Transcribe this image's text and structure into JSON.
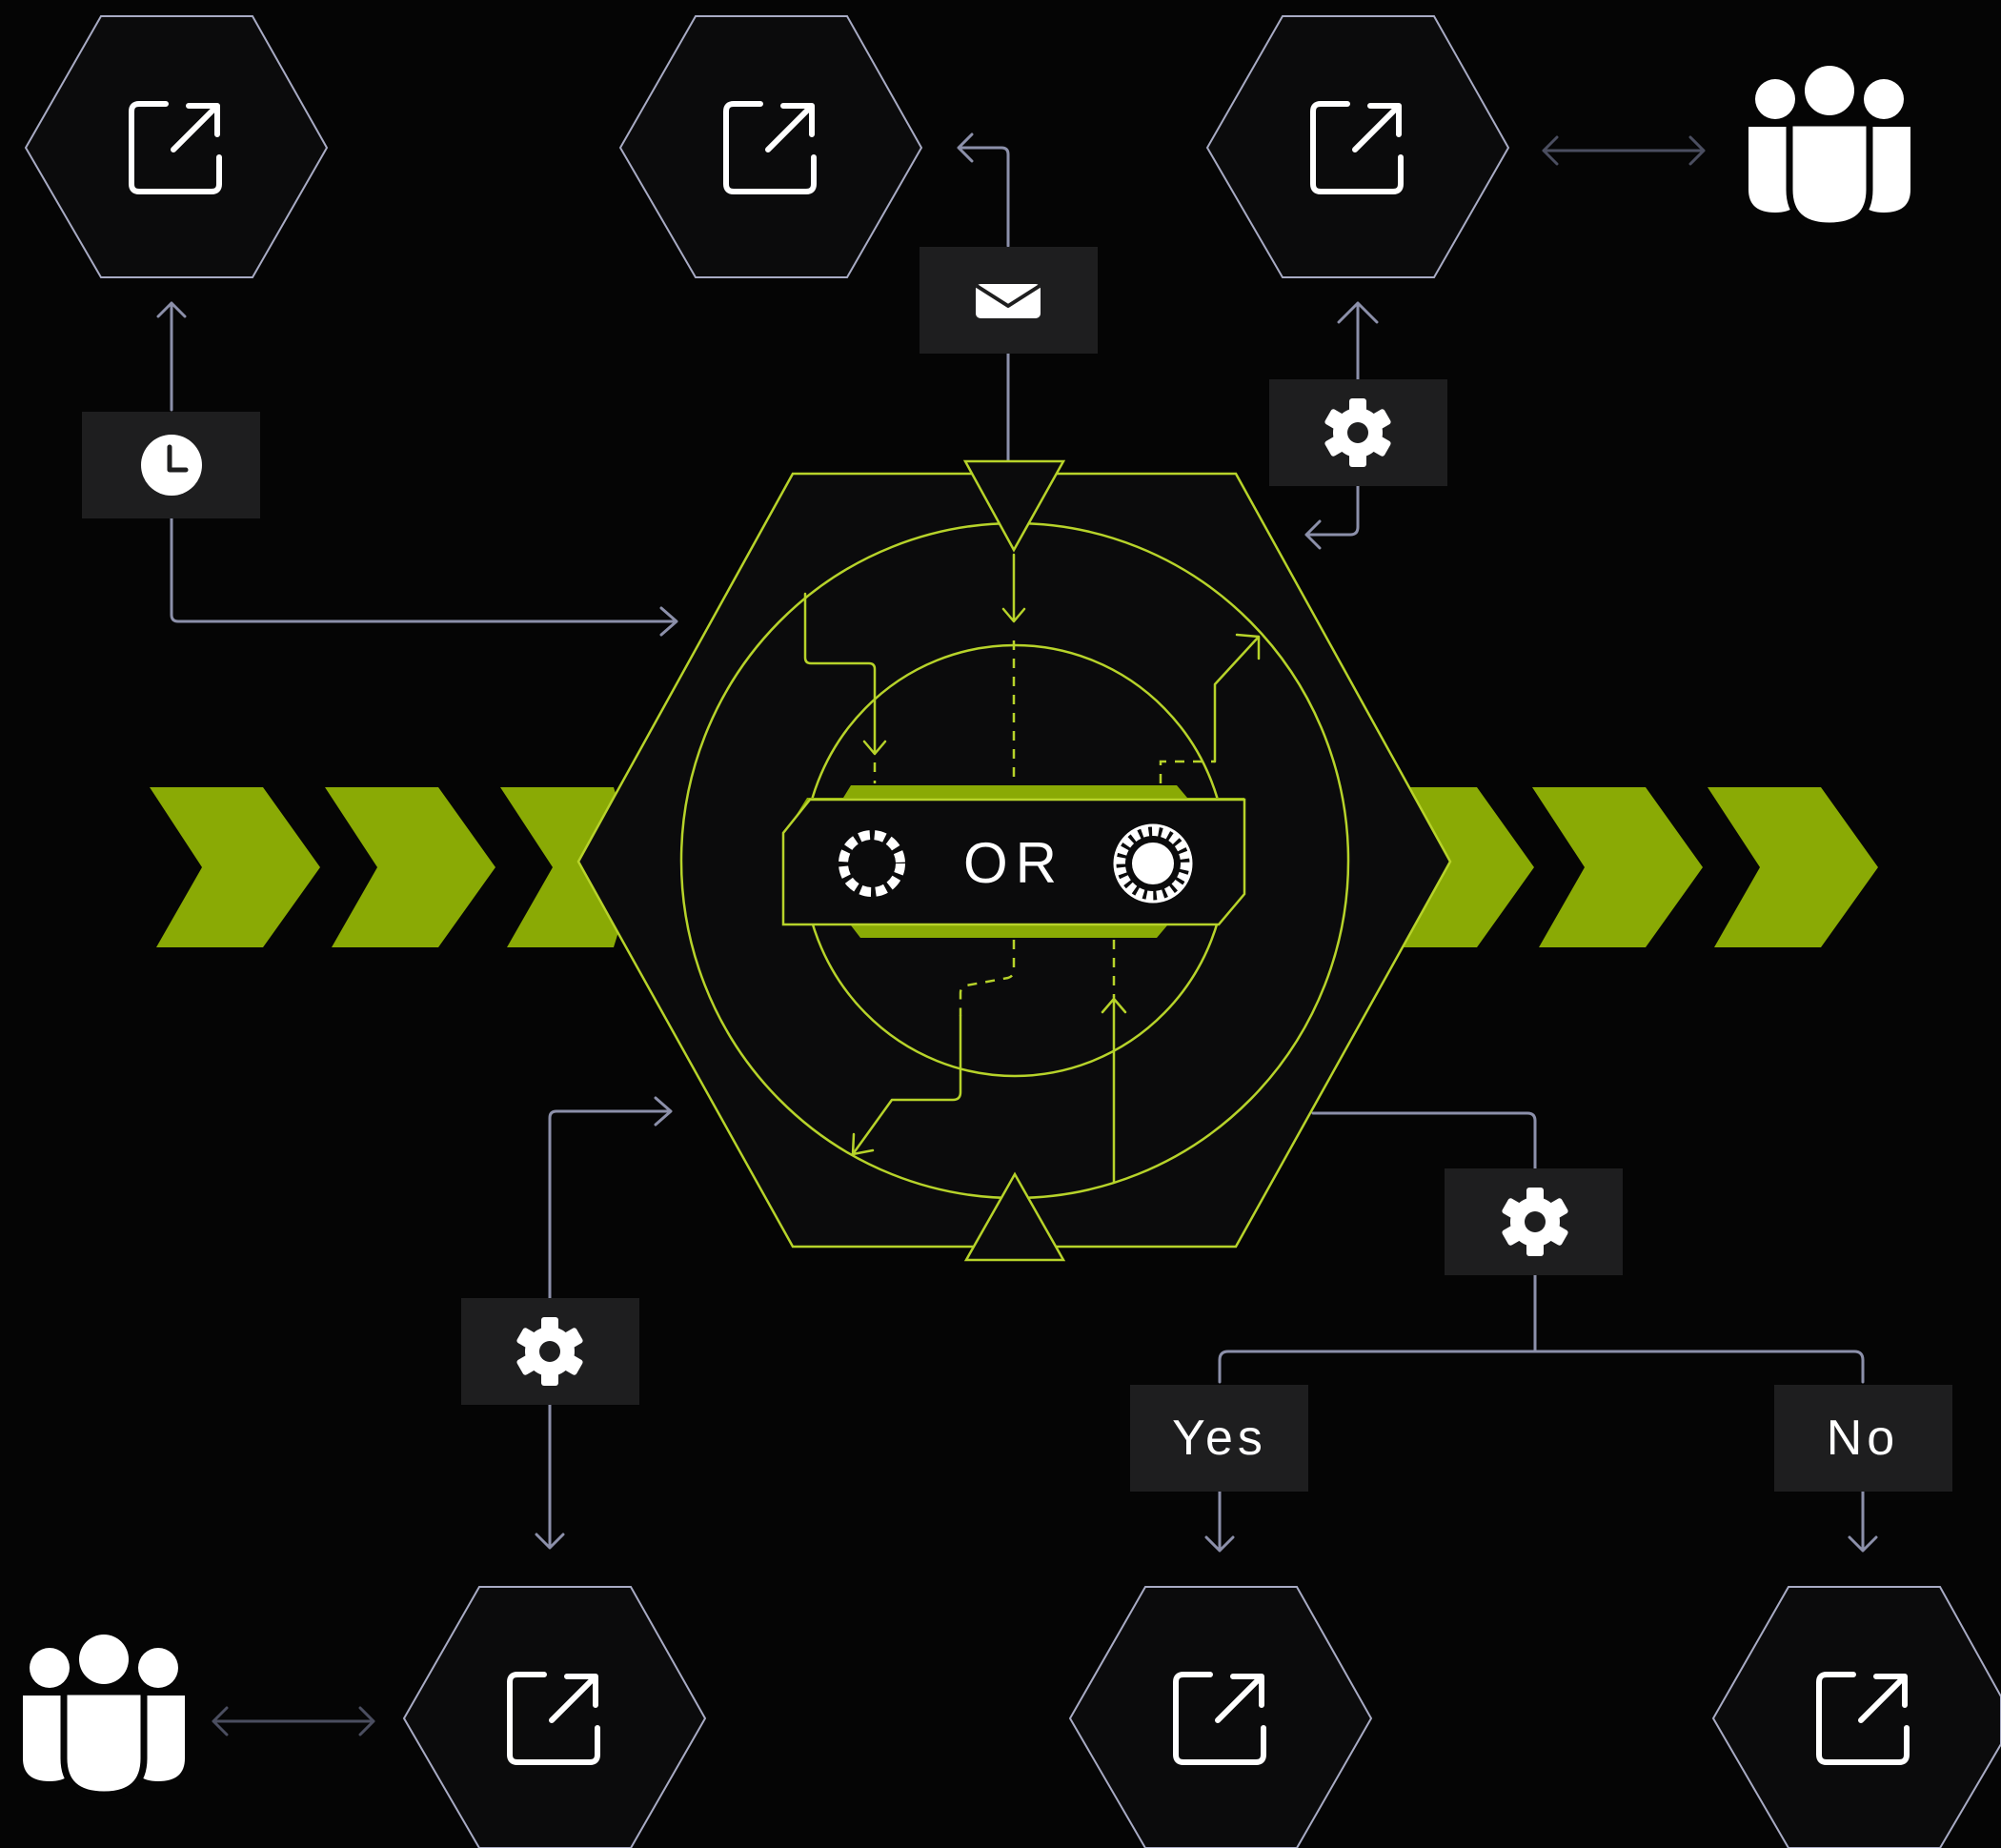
{
  "center": {
    "operator": "OR"
  },
  "decision": {
    "yes_label": "Yes",
    "no_label": "No"
  },
  "icons": {
    "node": "external-link-icon",
    "group": "users-group-icon",
    "trigger_timer": "clock-icon",
    "trigger_email": "envelope-icon",
    "settings": "gear-icon",
    "left_state": "dashed-ring-icon",
    "right_state": "filled-sun-icon"
  },
  "colors": {
    "background": "#050505",
    "node_outline": "#a8abc4",
    "accent_lime": "#b7d32a",
    "chevron_green": "#8aaa05",
    "label_box": "#1e1e1f"
  }
}
